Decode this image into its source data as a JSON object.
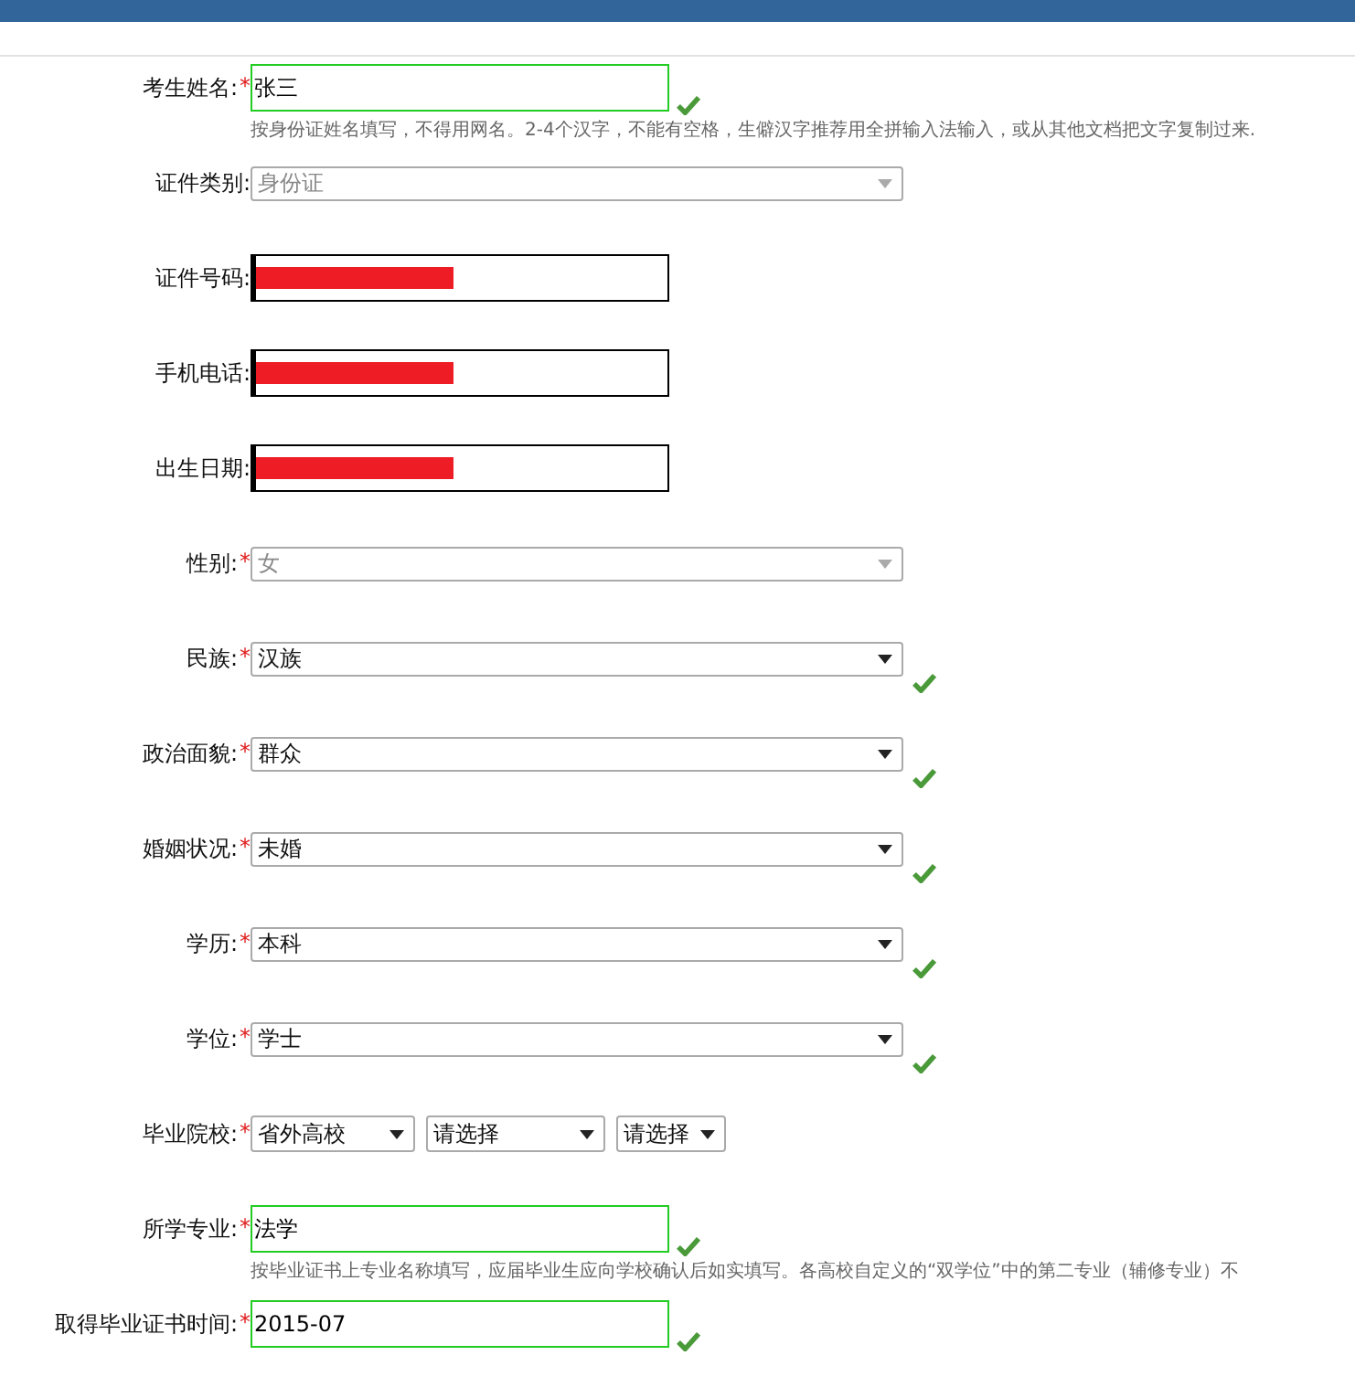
{
  "fields": [
    {
      "kind": "text",
      "label": "考生姓名:",
      "required_mark": "*",
      "value": "张三",
      "valid": true,
      "hint": "按身份证姓名填写，不得用网名。2-4个汉字，不能有空格，生僻汉字推荐用全拼输入法输入，或从其他文档把文字复制过来."
    },
    {
      "kind": "select",
      "label": "证件类别:",
      "value": "身份证",
      "disabled": true
    },
    {
      "kind": "text",
      "label": "证件号码:",
      "valid": false,
      "redacted": true
    },
    {
      "kind": "text",
      "label": "手机电话:",
      "valid": false,
      "redacted": true
    },
    {
      "kind": "text",
      "label": "出生日期:",
      "valid": false,
      "redacted": true
    },
    {
      "kind": "select",
      "label": "性别:",
      "required_mark": "*",
      "value": "女",
      "disabled": true
    },
    {
      "kind": "select",
      "label": "民族:",
      "required_mark": "*",
      "value": "汉族",
      "disabled": false,
      "valid": true
    },
    {
      "kind": "select",
      "label": "政治面貌:",
      "required_mark": "*",
      "value": "群众",
      "disabled": false,
      "valid": true
    },
    {
      "kind": "select",
      "label": "婚姻状况:",
      "required_mark": "*",
      "value": "未婚",
      "disabled": false,
      "valid": true
    },
    {
      "kind": "select",
      "label": "学历:",
      "required_mark": "*",
      "value": "本科",
      "disabled": false,
      "valid": true
    },
    {
      "kind": "select",
      "label": "学位:",
      "required_mark": "*",
      "value": "学士",
      "disabled": false,
      "valid": true
    },
    {
      "kind": "school",
      "label": "毕业院校:",
      "required_mark": "*",
      "selects": [
        "省外高校",
        "请选择",
        "请选择"
      ]
    },
    {
      "kind": "text",
      "label": "所学专业:",
      "required_mark": "*",
      "value": "法学",
      "valid": true,
      "hint": "按毕业证书上专业名称填写，应届毕业生应向学校确认后如实填写。各高校自定义的“双学位”中的第二专业（辅修专业）不"
    },
    {
      "kind": "text",
      "label": "取得毕业证书时间:",
      "required_mark": "*",
      "value": "2015-07",
      "valid": true
    }
  ]
}
